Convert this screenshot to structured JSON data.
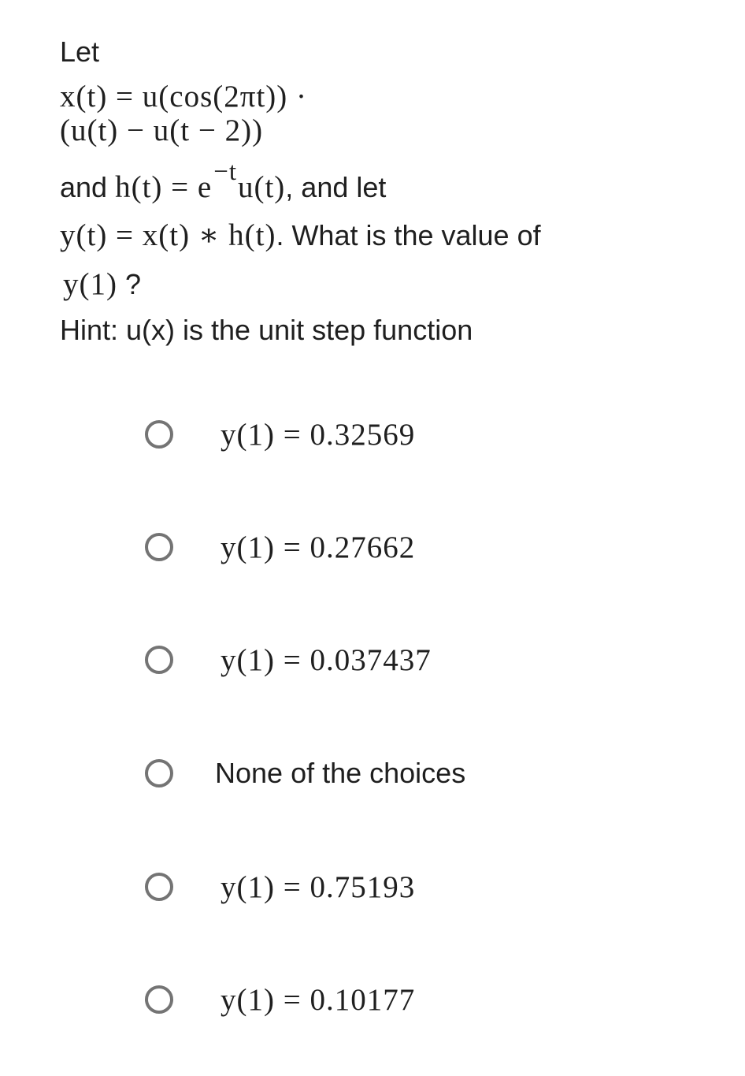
{
  "question": {
    "intro": "Let",
    "x_def_line1": "x(t) = u(cos(2πt)) ·",
    "x_def_line2": "(u(t) − u(t − 2))",
    "h_prefix": "and ",
    "h_lhs": "h(t) = e",
    "h_exponent": "−t",
    "h_rhs": "u(t)",
    "h_suffix": ", and let",
    "y_def": "y(t) = x(t) ∗ h(t)",
    "y_suffix": ". What is the value of",
    "target": "y(1)",
    "target_suffix": " ?",
    "hint": "Hint: u(x) is the unit step function"
  },
  "options": [
    {
      "label": "y(1) = 0.32569",
      "style": "math",
      "selected": false,
      "icon": "radio-unchecked-icon"
    },
    {
      "label": "y(1) = 0.27662",
      "style": "math",
      "selected": false,
      "icon": "radio-unchecked-icon"
    },
    {
      "label": "y(1) = 0.037437",
      "style": "math",
      "selected": false,
      "icon": "radio-unchecked-icon"
    },
    {
      "label": "None of the choices",
      "style": "text",
      "selected": false,
      "icon": "radio-unchecked-icon"
    },
    {
      "label": "y(1) = 0.75193",
      "style": "math",
      "selected": false,
      "icon": "radio-unchecked-icon"
    },
    {
      "label": "y(1) = 0.10177",
      "style": "math",
      "selected": false,
      "icon": "radio-unchecked-icon"
    }
  ],
  "colors": {
    "text": "#1f1f1f",
    "radio_border": "#747474",
    "background": "#ffffff"
  }
}
